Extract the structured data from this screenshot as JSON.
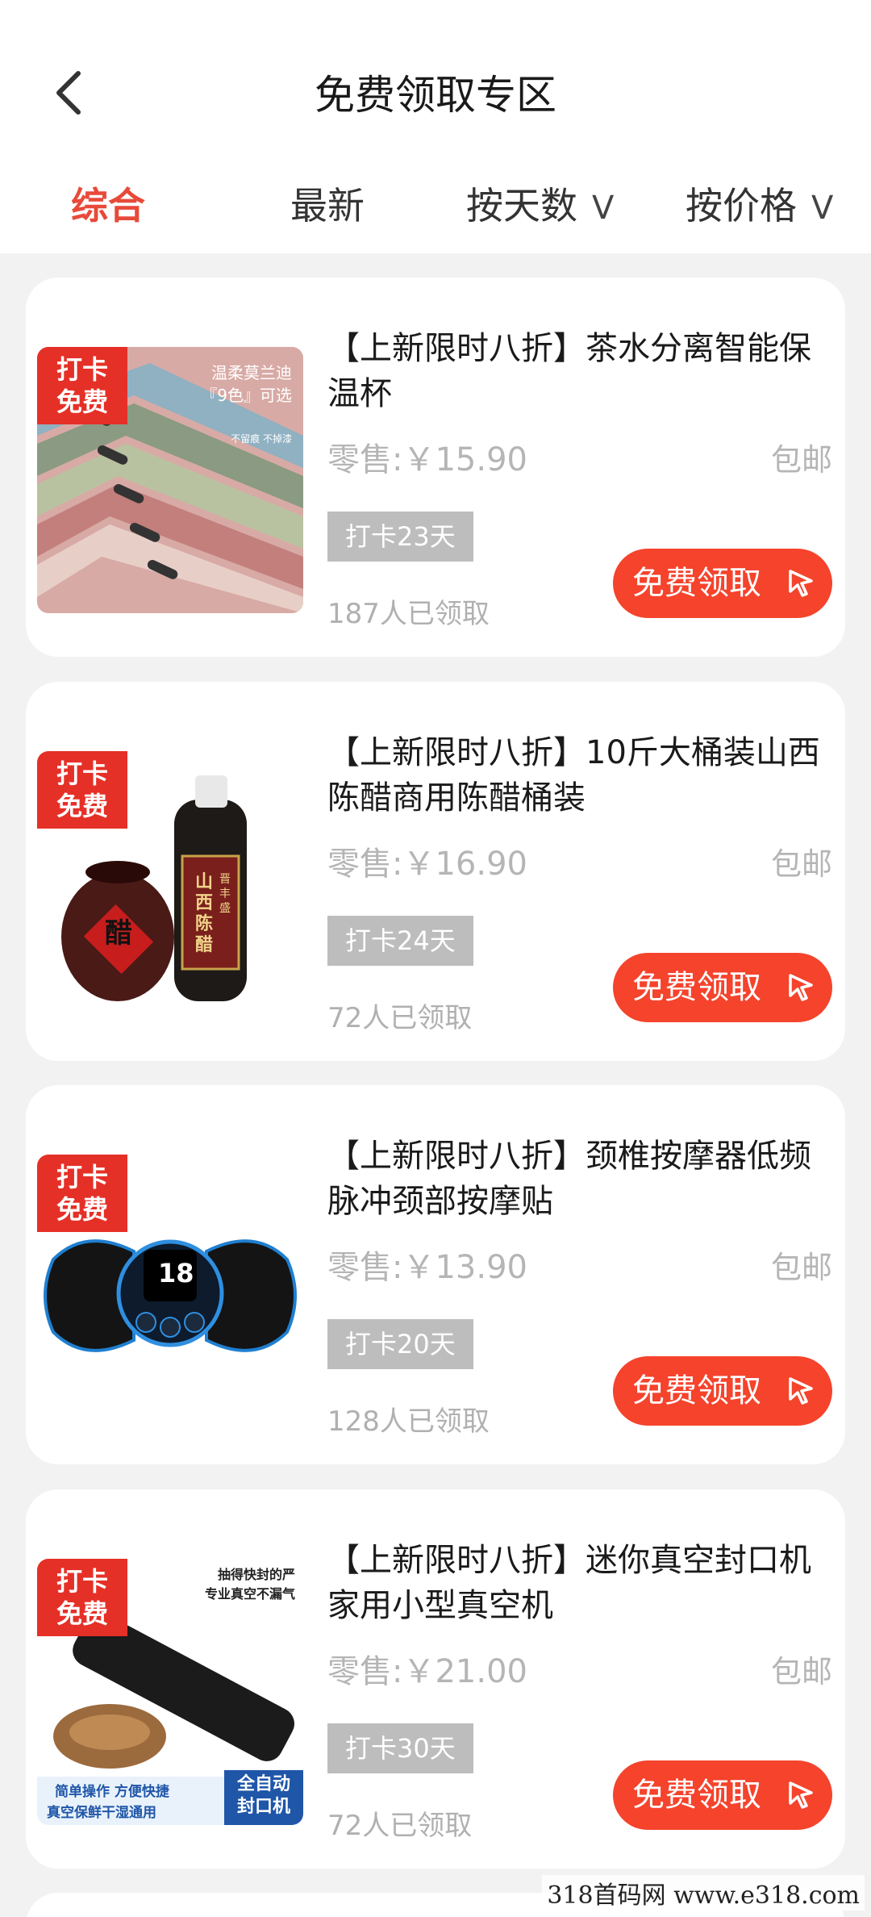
{
  "header": {
    "title": "免费领取专区",
    "back_icon": "chevron-left-icon"
  },
  "tabs": [
    {
      "label": "综合",
      "active": true
    },
    {
      "label": "最新",
      "active": false
    },
    {
      "label": "按天数",
      "caret": "V",
      "active": false
    },
    {
      "label": "按价格",
      "caret": "V",
      "active": false
    }
  ],
  "products": [
    {
      "ribbon_line1": "打卡",
      "ribbon_line2": "免费",
      "image_text_1": "温柔莫兰迪",
      "image_text_2": "『9色』可选",
      "image_text_3": "不留痕  不掉漆",
      "title": "【上新限时八折】茶水分离智能保温杯",
      "retail": "零售:￥15.90",
      "shipping": "包邮",
      "days": "打卡23天",
      "claimed": "187人已领取",
      "button": "免费领取"
    },
    {
      "ribbon_line1": "打卡",
      "ribbon_line2": "免费",
      "image_text_1": "醋",
      "image_text_2": "山西陈醋",
      "image_text_3": "晋丰盛",
      "title": "【上新限时八折】10斤大桶装山西陈醋商用陈醋桶装",
      "retail": "零售:￥16.90",
      "shipping": "包邮",
      "days": "打卡24天",
      "claimed": "72人已领取",
      "button": "免费领取"
    },
    {
      "ribbon_line1": "打卡",
      "ribbon_line2": "免费",
      "image_text_1": "18",
      "title": "【上新限时八折】颈椎按摩器低频脉冲颈部按摩贴",
      "retail": "零售:￥13.90",
      "shipping": "包邮",
      "days": "打卡20天",
      "claimed": "128人已领取",
      "button": "免费领取"
    },
    {
      "ribbon_line1": "打卡",
      "ribbon_line2": "免费",
      "image_text_1": "抽得快封的严",
      "image_text_2": "专业真空不漏气",
      "image_text_3": "简单操作 方便快捷",
      "image_text_4": "真空保鲜干湿通用",
      "image_text_5": "全自动",
      "image_text_6": "封口机",
      "title": "【上新限时八折】迷你真空封口机家用小型真空机",
      "retail": "零售:￥21.00",
      "shipping": "包邮",
      "days": "打卡30天",
      "claimed": "72人已领取",
      "button": "免费领取"
    }
  ],
  "watermark": "318首码网  www.e318.com",
  "colors": {
    "accent": "#e84a3a",
    "button": "#f5432c",
    "ribbon": "#e53027",
    "badge": "#bdbdbd"
  }
}
